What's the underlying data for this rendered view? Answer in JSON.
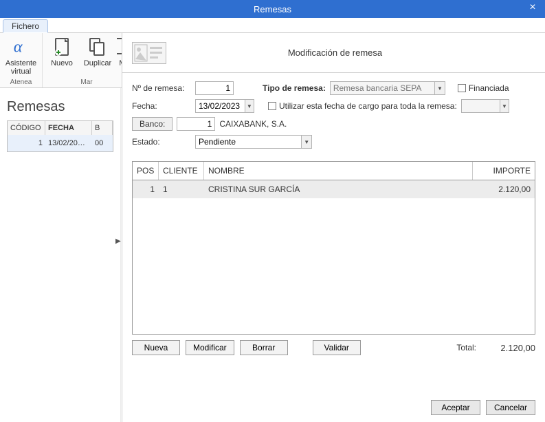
{
  "titlebar": {
    "title": "Remesas",
    "close": "×"
  },
  "tabs": {
    "fichero": "Fichero"
  },
  "ribbon": {
    "assistant": {
      "label": "Asistente\nvirtual",
      "group": "Atenea"
    },
    "nuevo": "Nuevo",
    "duplicar": "Duplicar",
    "m": "M",
    "group2": "Mar"
  },
  "left": {
    "heading": "Remesas",
    "headers": {
      "codigo": "CÓDIGO",
      "fecha": "FECHA",
      "b": "B"
    },
    "rows": [
      {
        "codigo": "1",
        "fecha": "13/02/20…",
        "b": "00"
      }
    ]
  },
  "modal": {
    "title": "Modificación de remesa",
    "form": {
      "num_label": "Nº de remesa:",
      "num_value": "1",
      "tipo_label": "Tipo de remesa:",
      "tipo_value": "Remesa bancaria SEPA",
      "financiada_label": "Financiada",
      "fecha_label": "Fecha:",
      "fecha_value": "13/02/2023",
      "usar_fecha_label": "Utilizar esta fecha de cargo para toda la remesa:",
      "banco_label": "Banco:",
      "banco_code": "1",
      "banco_name": "CAIXABANK, S.A.",
      "estado_label": "Estado:",
      "estado_value": "Pendiente"
    },
    "grid": {
      "headers": {
        "pos": "POS",
        "cliente": "CLIENTE",
        "nombre": "NOMBRE",
        "importe": "IMPORTE"
      },
      "rows": [
        {
          "pos": "1",
          "cliente": "1",
          "nombre": "CRISTINA SUR GARCÍA",
          "importe": "2.120,00"
        }
      ]
    },
    "buttons": {
      "nueva": "Nueva",
      "modificar": "Modificar",
      "borrar": "Borrar",
      "validar": "Validar"
    },
    "total_label": "Total:",
    "total_value": "2.120,00",
    "footer": {
      "aceptar": "Aceptar",
      "cancelar": "Cancelar"
    }
  }
}
